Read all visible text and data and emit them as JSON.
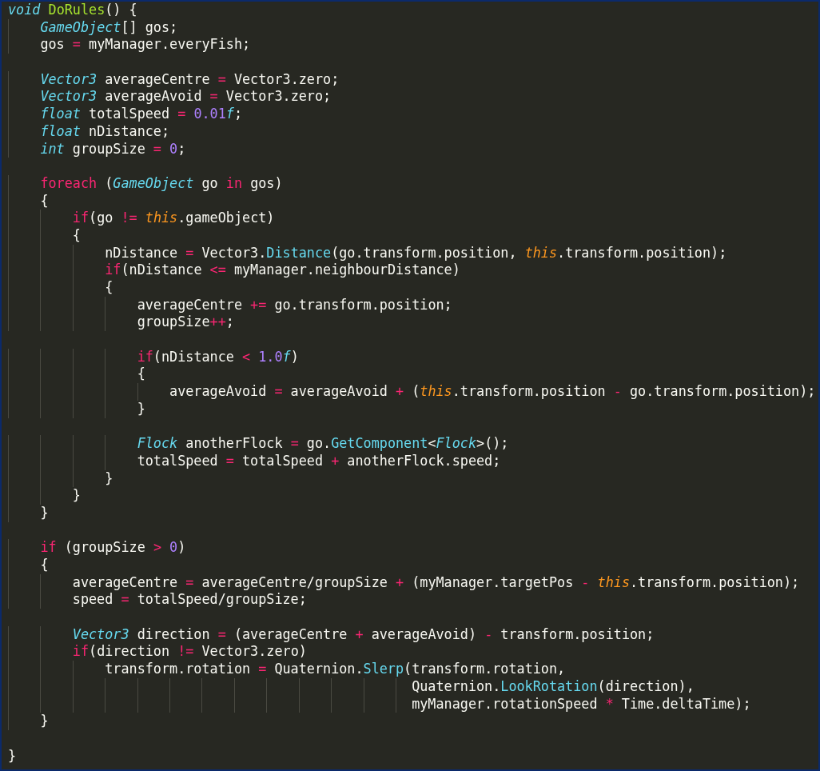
{
  "editor": {
    "lines": [
      {
        "kind": "code",
        "tokens": [
          {
            "kind": "type",
            "text": "void"
          },
          {
            "kind": "def",
            "text": " DoRules"
          },
          {
            "kind": "plain",
            "text": "() {"
          }
        ]
      },
      {
        "kind": "code",
        "tokens": [
          {
            "kind": "type",
            "text": "    GameObject"
          },
          {
            "kind": "plain",
            "text": "[] gos;"
          }
        ]
      },
      {
        "kind": "code",
        "tokens": [
          {
            "kind": "plain",
            "text": "    gos "
          },
          {
            "kind": "op",
            "text": "="
          },
          {
            "kind": "plain",
            "text": " myManager.everyFish;"
          }
        ]
      },
      {
        "kind": "blank"
      },
      {
        "kind": "code",
        "tokens": [
          {
            "kind": "type",
            "text": "    Vector3"
          },
          {
            "kind": "plain",
            "text": " averageCentre "
          },
          {
            "kind": "op",
            "text": "="
          },
          {
            "kind": "plain",
            "text": " Vector3.zero;"
          }
        ]
      },
      {
        "kind": "code",
        "tokens": [
          {
            "kind": "type",
            "text": "    Vector3"
          },
          {
            "kind": "plain",
            "text": " averageAvoid "
          },
          {
            "kind": "op",
            "text": "="
          },
          {
            "kind": "plain",
            "text": " Vector3.zero;"
          }
        ]
      },
      {
        "kind": "code",
        "tokens": [
          {
            "kind": "type",
            "text": "    float"
          },
          {
            "kind": "plain",
            "text": " totalSpeed "
          },
          {
            "kind": "op",
            "text": "="
          },
          {
            "kind": "number",
            "text": " 0.01"
          },
          {
            "kind": "type",
            "text": "f"
          },
          {
            "kind": "plain",
            "text": ";"
          }
        ]
      },
      {
        "kind": "code",
        "tokens": [
          {
            "kind": "type",
            "text": "    float"
          },
          {
            "kind": "plain",
            "text": " nDistance;"
          }
        ]
      },
      {
        "kind": "code",
        "tokens": [
          {
            "kind": "type",
            "text": "    int"
          },
          {
            "kind": "plain",
            "text": " groupSize "
          },
          {
            "kind": "op",
            "text": "="
          },
          {
            "kind": "number",
            "text": " 0"
          },
          {
            "kind": "plain",
            "text": ";"
          }
        ]
      },
      {
        "kind": "blank"
      },
      {
        "kind": "code",
        "tokens": [
          {
            "kind": "keyword",
            "text": "    foreach"
          },
          {
            "kind": "plain",
            "text": " ("
          },
          {
            "kind": "type",
            "text": "GameObject"
          },
          {
            "kind": "plain",
            "text": " go "
          },
          {
            "kind": "keyword",
            "text": "in"
          },
          {
            "kind": "plain",
            "text": " gos)"
          }
        ]
      },
      {
        "kind": "code",
        "tokens": [
          {
            "kind": "plain",
            "text": "    {"
          }
        ]
      },
      {
        "kind": "code",
        "tokens": [
          {
            "kind": "keyword",
            "text": "        if"
          },
          {
            "kind": "plain",
            "text": "(go "
          },
          {
            "kind": "op",
            "text": "!="
          },
          {
            "kind": "this",
            "text": " this"
          },
          {
            "kind": "plain",
            "text": ".gameObject)"
          }
        ]
      },
      {
        "kind": "code",
        "tokens": [
          {
            "kind": "plain",
            "text": "        {"
          }
        ]
      },
      {
        "kind": "code",
        "tokens": [
          {
            "kind": "plain",
            "text": "            nDistance "
          },
          {
            "kind": "op",
            "text": "="
          },
          {
            "kind": "plain",
            "text": " Vector3."
          },
          {
            "kind": "call",
            "text": "Distance"
          },
          {
            "kind": "plain",
            "text": "(go.transform.position, "
          },
          {
            "kind": "this",
            "text": "this"
          },
          {
            "kind": "plain",
            "text": ".transform.position);"
          }
        ]
      },
      {
        "kind": "code",
        "tokens": [
          {
            "kind": "keyword",
            "text": "            if"
          },
          {
            "kind": "plain",
            "text": "(nDistance "
          },
          {
            "kind": "op",
            "text": "<="
          },
          {
            "kind": "plain",
            "text": " myManager.neighbourDistance)"
          }
        ]
      },
      {
        "kind": "code",
        "tokens": [
          {
            "kind": "plain",
            "text": "            {"
          }
        ]
      },
      {
        "kind": "code",
        "tokens": [
          {
            "kind": "plain",
            "text": "                averageCentre "
          },
          {
            "kind": "op",
            "text": "+="
          },
          {
            "kind": "plain",
            "text": " go.transform.position;"
          }
        ]
      },
      {
        "kind": "code",
        "tokens": [
          {
            "kind": "plain",
            "text": "                groupSize"
          },
          {
            "kind": "op",
            "text": "++"
          },
          {
            "kind": "plain",
            "text": ";"
          }
        ]
      },
      {
        "kind": "blank"
      },
      {
        "kind": "code",
        "tokens": [
          {
            "kind": "keyword",
            "text": "                if"
          },
          {
            "kind": "plain",
            "text": "(nDistance "
          },
          {
            "kind": "op",
            "text": "<"
          },
          {
            "kind": "number",
            "text": " 1.0"
          },
          {
            "kind": "type",
            "text": "f"
          },
          {
            "kind": "plain",
            "text": ")"
          }
        ]
      },
      {
        "kind": "code",
        "tokens": [
          {
            "kind": "plain",
            "text": "                {"
          }
        ]
      },
      {
        "kind": "code",
        "tokens": [
          {
            "kind": "plain",
            "text": "                    averageAvoid "
          },
          {
            "kind": "op",
            "text": "="
          },
          {
            "kind": "plain",
            "text": " averageAvoid "
          },
          {
            "kind": "op",
            "text": "+"
          },
          {
            "kind": "plain",
            "text": " ("
          },
          {
            "kind": "this",
            "text": "this"
          },
          {
            "kind": "plain",
            "text": ".transform.position "
          },
          {
            "kind": "op",
            "text": "-"
          },
          {
            "kind": "plain",
            "text": " go.transform.position);"
          }
        ]
      },
      {
        "kind": "code",
        "tokens": [
          {
            "kind": "plain",
            "text": "                }"
          }
        ]
      },
      {
        "kind": "blank"
      },
      {
        "kind": "code",
        "tokens": [
          {
            "kind": "type",
            "text": "                Flock"
          },
          {
            "kind": "plain",
            "text": " anotherFlock "
          },
          {
            "kind": "op",
            "text": "="
          },
          {
            "kind": "plain",
            "text": " go."
          },
          {
            "kind": "call",
            "text": "GetComponent"
          },
          {
            "kind": "plain",
            "text": "<"
          },
          {
            "kind": "type",
            "text": "Flock"
          },
          {
            "kind": "plain",
            "text": ">();"
          }
        ]
      },
      {
        "kind": "code",
        "tokens": [
          {
            "kind": "plain",
            "text": "                totalSpeed "
          },
          {
            "kind": "op",
            "text": "="
          },
          {
            "kind": "plain",
            "text": " totalSpeed "
          },
          {
            "kind": "op",
            "text": "+"
          },
          {
            "kind": "plain",
            "text": " anotherFlock.speed;"
          }
        ]
      },
      {
        "kind": "code",
        "tokens": [
          {
            "kind": "plain",
            "text": "            }"
          }
        ]
      },
      {
        "kind": "code",
        "tokens": [
          {
            "kind": "plain",
            "text": "        }"
          }
        ]
      },
      {
        "kind": "code",
        "tokens": [
          {
            "kind": "plain",
            "text": "    }"
          }
        ]
      },
      {
        "kind": "blank"
      },
      {
        "kind": "code",
        "tokens": [
          {
            "kind": "keyword",
            "text": "    if"
          },
          {
            "kind": "plain",
            "text": " (groupSize "
          },
          {
            "kind": "op",
            "text": ">"
          },
          {
            "kind": "number",
            "text": " 0"
          },
          {
            "kind": "plain",
            "text": ")"
          }
        ]
      },
      {
        "kind": "code",
        "tokens": [
          {
            "kind": "plain",
            "text": "    {"
          }
        ]
      },
      {
        "kind": "code",
        "tokens": [
          {
            "kind": "plain",
            "text": "        averageCentre "
          },
          {
            "kind": "op",
            "text": "="
          },
          {
            "kind": "plain",
            "text": " averageCentre/groupSize "
          },
          {
            "kind": "op",
            "text": "+"
          },
          {
            "kind": "plain",
            "text": " (myManager.targetPos "
          },
          {
            "kind": "op",
            "text": "-"
          },
          {
            "kind": "this",
            "text": " this"
          },
          {
            "kind": "plain",
            "text": ".transform.position);"
          }
        ]
      },
      {
        "kind": "code",
        "tokens": [
          {
            "kind": "plain",
            "text": "        speed "
          },
          {
            "kind": "op",
            "text": "="
          },
          {
            "kind": "plain",
            "text": " totalSpeed/groupSize;"
          }
        ]
      },
      {
        "kind": "blank"
      },
      {
        "kind": "code",
        "tokens": [
          {
            "kind": "type",
            "text": "        Vector3"
          },
          {
            "kind": "plain",
            "text": " direction "
          },
          {
            "kind": "op",
            "text": "="
          },
          {
            "kind": "plain",
            "text": " (averageCentre "
          },
          {
            "kind": "op",
            "text": "+"
          },
          {
            "kind": "plain",
            "text": " averageAvoid) "
          },
          {
            "kind": "op",
            "text": "-"
          },
          {
            "kind": "plain",
            "text": " transform.position;"
          }
        ]
      },
      {
        "kind": "code",
        "tokens": [
          {
            "kind": "keyword",
            "text": "        if"
          },
          {
            "kind": "plain",
            "text": "(direction "
          },
          {
            "kind": "op",
            "text": "!="
          },
          {
            "kind": "plain",
            "text": " Vector3.zero)"
          }
        ]
      },
      {
        "kind": "code",
        "tokens": [
          {
            "kind": "plain",
            "text": "            transform.rotation "
          },
          {
            "kind": "op",
            "text": "="
          },
          {
            "kind": "plain",
            "text": " Quaternion."
          },
          {
            "kind": "call",
            "text": "Slerp"
          },
          {
            "kind": "plain",
            "text": "(transform.rotation,"
          }
        ]
      },
      {
        "kind": "code",
        "tokens": [
          {
            "kind": "plain",
            "text": "                                                  Quaternion."
          },
          {
            "kind": "call",
            "text": "LookRotation"
          },
          {
            "kind": "plain",
            "text": "(direction),"
          }
        ]
      },
      {
        "kind": "code",
        "tokens": [
          {
            "kind": "plain",
            "text": "                                                  myManager.rotationSpeed "
          },
          {
            "kind": "op",
            "text": "*"
          },
          {
            "kind": "plain",
            "text": " Time.deltaTime);"
          }
        ]
      },
      {
        "kind": "code",
        "tokens": [
          {
            "kind": "plain",
            "text": "    }"
          }
        ]
      },
      {
        "kind": "blank"
      },
      {
        "kind": "code",
        "tokens": [
          {
            "kind": "plain",
            "text": "}"
          }
        ]
      }
    ]
  }
}
